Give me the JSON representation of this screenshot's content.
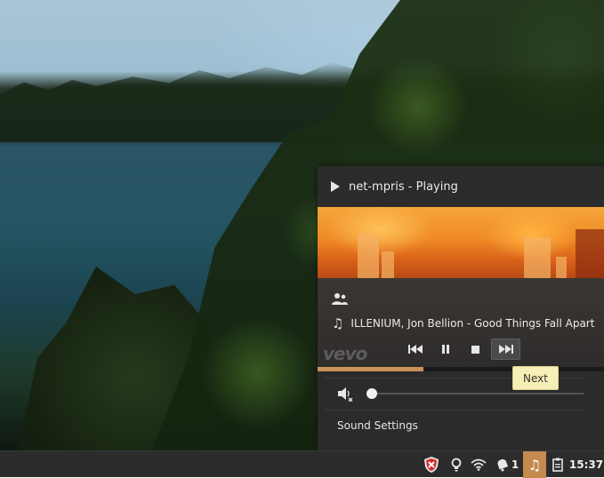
{
  "panel": {
    "title": "net-mpris - Playing",
    "track": "ILLENIUM, Jon Bellion - Good Things Fall Apart ...",
    "watermark": "vevo",
    "progress_fraction": 0.37,
    "volume_fraction": 0.0,
    "sound_settings_label": "Sound Settings",
    "controls": {
      "previous_icon": "skip-previous-icon",
      "pause_icon": "pause-icon",
      "stop_icon": "stop-icon",
      "next_icon": "skip-next-icon"
    }
  },
  "tooltip": {
    "text": "Next"
  },
  "taskbar": {
    "notification_count": "1",
    "clock": "15:37",
    "accent_color": "#c58a4e",
    "tray_icons": [
      "shield-error-icon",
      "lightbulb-icon",
      "wifi-icon",
      "notification-bell-icon",
      "music-note-icon",
      "clipboard-icon"
    ]
  }
}
